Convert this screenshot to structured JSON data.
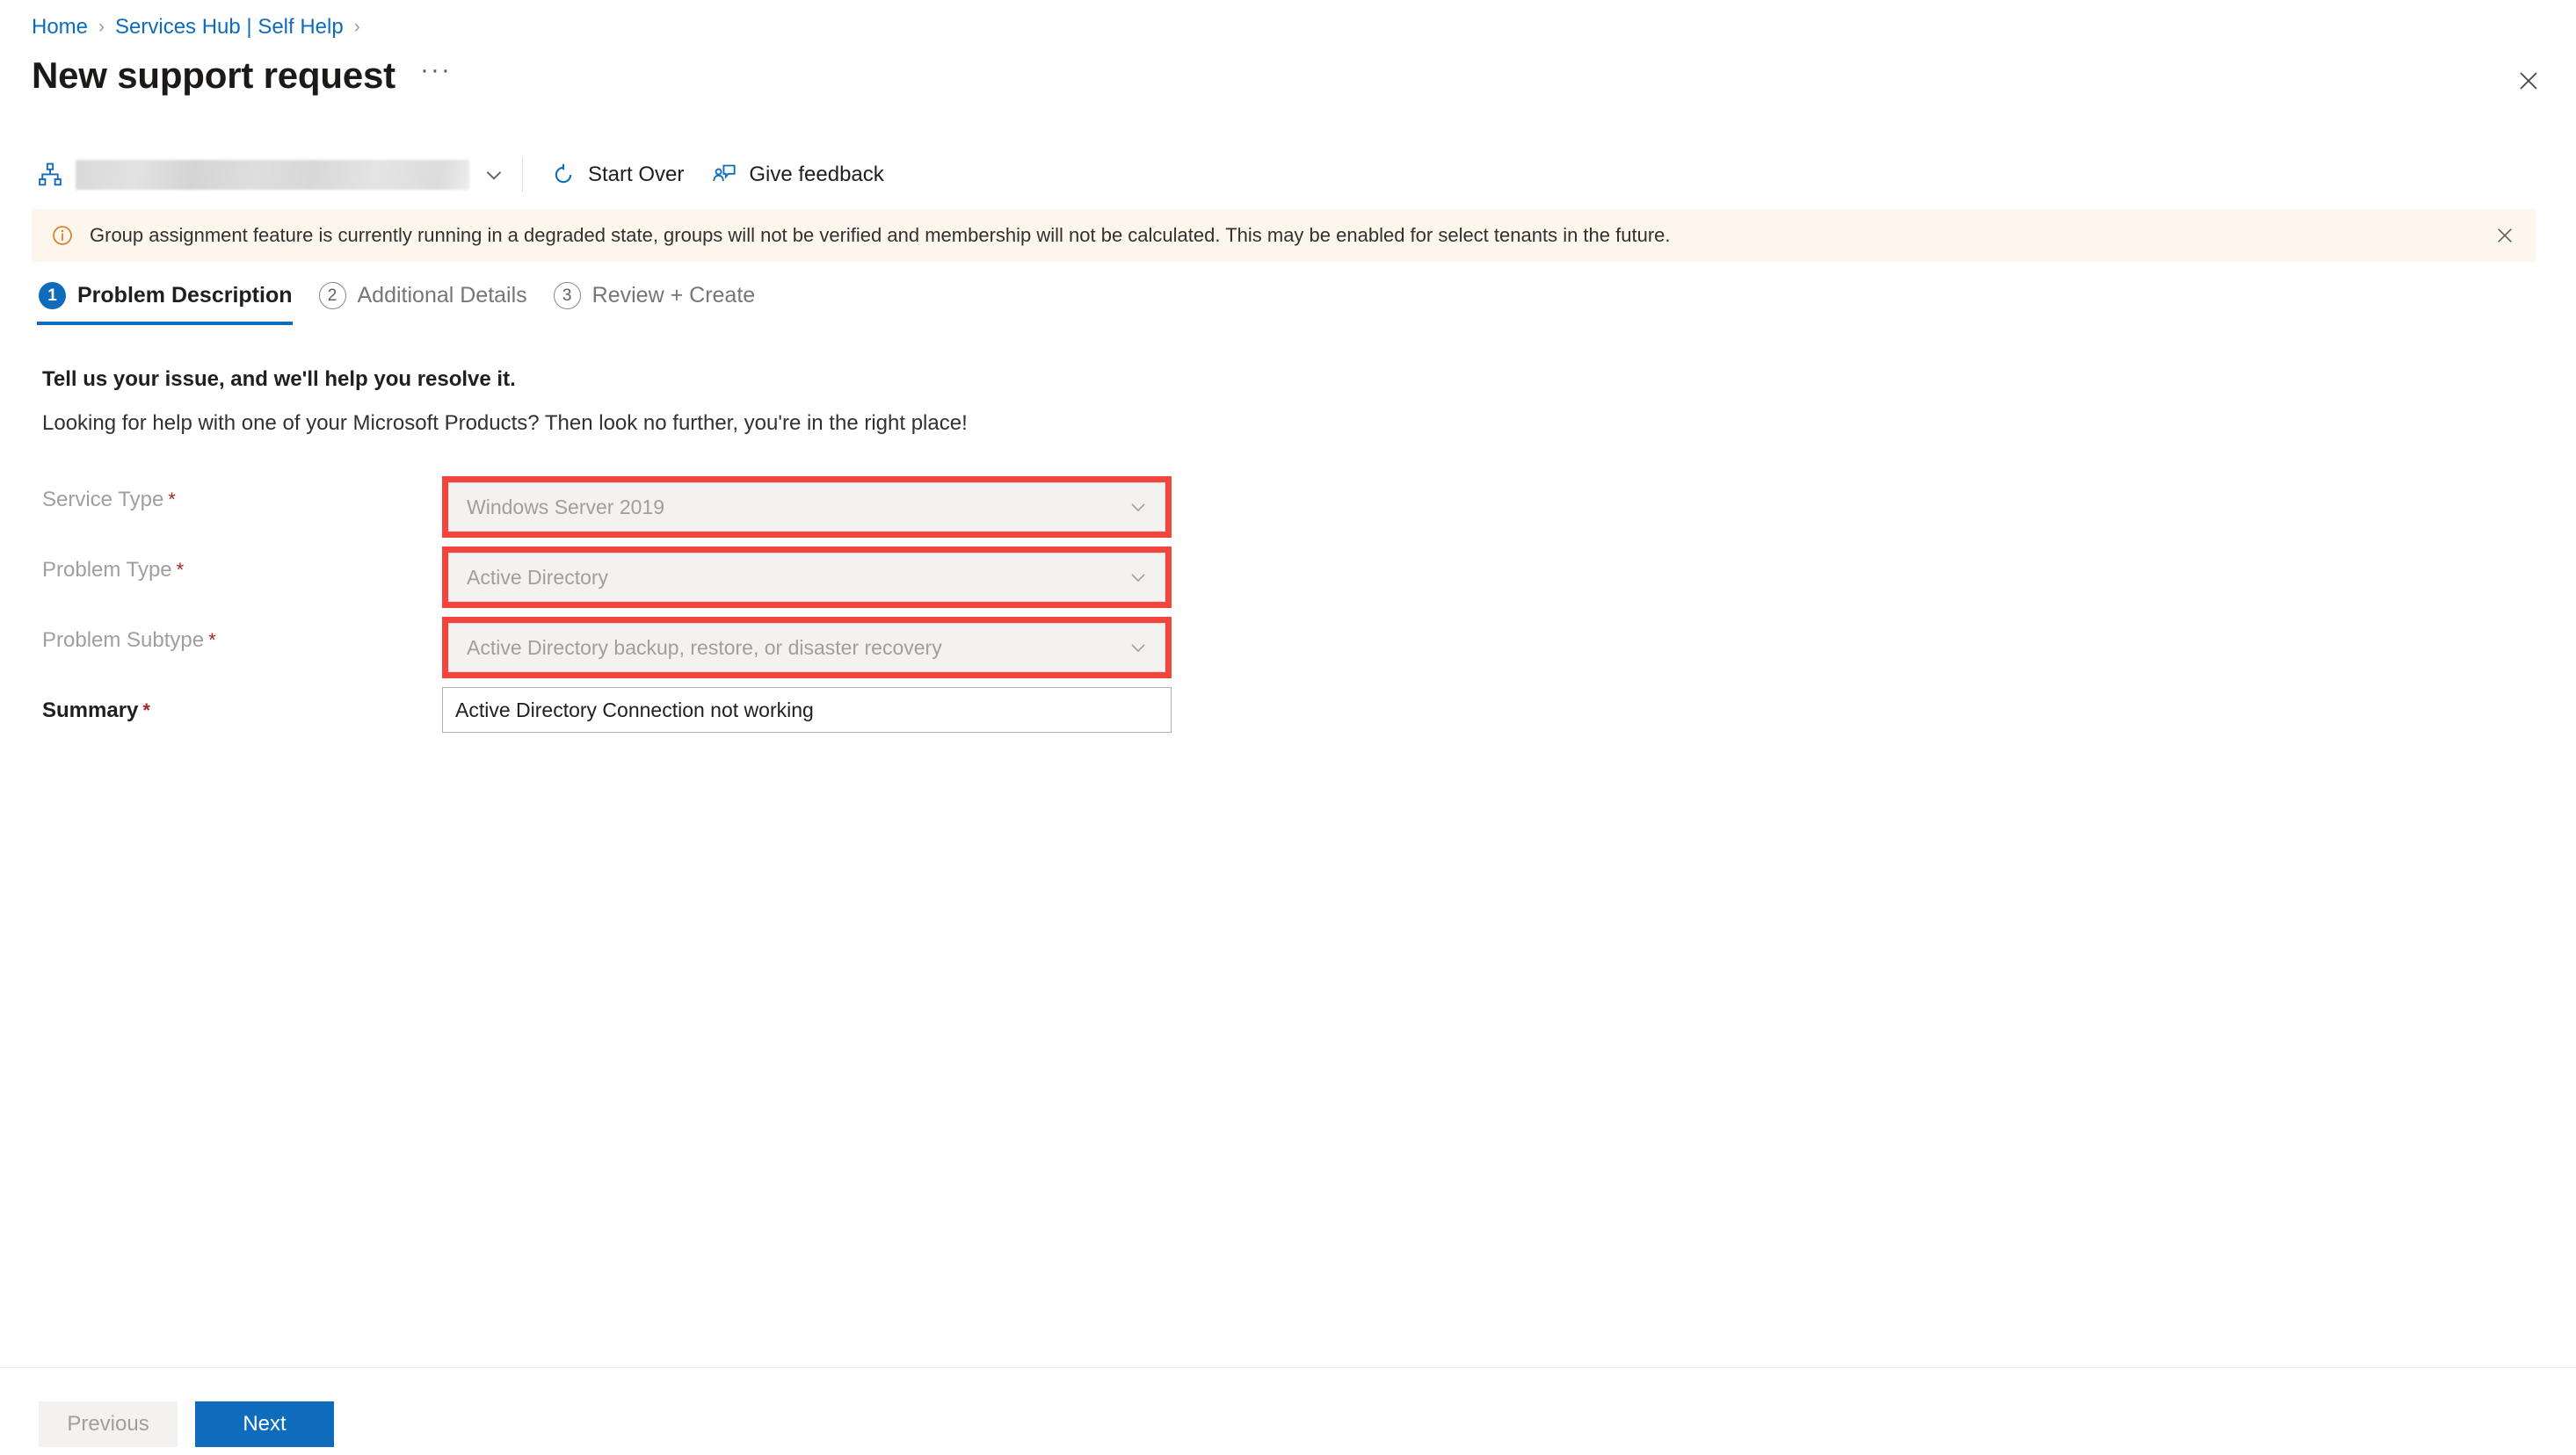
{
  "breadcrumb": {
    "items": [
      {
        "label": "Home"
      },
      {
        "label": "Services Hub | Self Help"
      }
    ],
    "separator": "›"
  },
  "header": {
    "title": "New support request",
    "more_label": "···",
    "close_label": "✕"
  },
  "command_bar": {
    "tenant_picker": {
      "icon": "org-hierarchy-icon",
      "value": "",
      "caret": "∨"
    },
    "buttons": [
      {
        "label": "Start Over",
        "icon": "refresh-icon"
      },
      {
        "label": "Give feedback",
        "icon": "feedback-person-icon"
      }
    ]
  },
  "message_bar": {
    "icon": "info-circle-icon",
    "text": "Group assignment feature is currently running in a degraded state, groups will not be verified and membership will not be calculated. This may be enabled for select tenants in the future.",
    "close_label": "✕",
    "background_color": "#FDF6EC",
    "icon_color": "#D9822B"
  },
  "steps": [
    {
      "number": "1",
      "label": "Problem Description",
      "state": "active"
    },
    {
      "number": "2",
      "label": "Additional Details",
      "state": "inactive"
    },
    {
      "number": "3",
      "label": "Review + Create",
      "state": "inactive"
    }
  ],
  "content": {
    "lead": "Tell us your issue, and we'll help you resolve it.",
    "subtext": "Looking for help with one of your Microsoft Products? Then look no further, you're in the right place!"
  },
  "form": {
    "required_marker": "*",
    "fields": [
      {
        "label": "Service Type",
        "value": "Windows Server 2019",
        "type": "dropdown",
        "state": "disabled",
        "highlighted": true,
        "caret": "∨"
      },
      {
        "label": "Problem Type",
        "value": "Active Directory",
        "type": "dropdown",
        "state": "disabled",
        "highlighted": true,
        "caret": "∨"
      },
      {
        "label": "Problem Subtype",
        "value": "Active Directory backup, restore, or disaster recovery",
        "type": "dropdown",
        "state": "disabled",
        "highlighted": true,
        "caret": "∨"
      },
      {
        "label": "Summary",
        "value": "Active Directory Connection not working",
        "placeholder": "",
        "type": "text",
        "state": "enabled",
        "highlighted": false
      }
    ]
  },
  "footer": {
    "previous_label": "Previous",
    "next_label": "Next"
  },
  "colors": {
    "accent": "#0F6CBD",
    "annotation_red": "#F2453D",
    "required_red": "#A4262C",
    "warning_bg": "#FDF6EC"
  }
}
